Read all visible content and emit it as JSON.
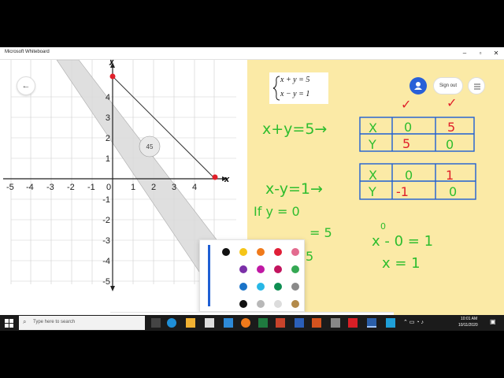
{
  "window": {
    "title": "Microsoft Whiteboard",
    "minimize": "–",
    "maximize": "▫",
    "close": "✕"
  },
  "header": {
    "back_icon": "←",
    "signout_label": "Sign out"
  },
  "equation_card": {
    "line1": "x + y = 5",
    "line2": "x − y = 1"
  },
  "graph": {
    "x_ticks": [
      "-5",
      "-4",
      "-3",
      "-2",
      "-1",
      "0",
      "1",
      "2",
      "3",
      "4"
    ],
    "y_ticks": [
      "4",
      "3",
      "2",
      "1",
      "-1",
      "-2",
      "-3",
      "-4",
      "-5"
    ],
    "x_label": "x",
    "y_label": "y",
    "ruler_angle": "45"
  },
  "notes": {
    "eq1": "x+y=5→",
    "eq2": "x-y=1→",
    "checks": [
      "✓",
      "✓"
    ],
    "table1": {
      "row1": [
        "X",
        "0",
        "5"
      ],
      "row2": [
        "Y",
        "5",
        "0"
      ]
    },
    "table2": {
      "row1": [
        "X",
        "0",
        "1"
      ],
      "row2": [
        "Y",
        "-1",
        "0"
      ]
    },
    "if_line": "If y = 0",
    "partial1": "= 5",
    "partial2": "5",
    "step1": "x - 0 = 1",
    "step_small": "0",
    "step2": "x = 1"
  },
  "palette_colors": [
    "#111111",
    "#f5c518",
    "#f07a1b",
    "#e01e37",
    "#e36b8f",
    "#7b2fa8",
    "#c018a4",
    "#c2145e",
    "#34a853",
    "#1a73c8",
    "#27b7e6",
    "#0e8e52",
    "#8a8a8a",
    "#111111",
    "#b8b8b8",
    "#dcdcdc",
    "#b38a4a"
  ],
  "taskbar": {
    "search_placeholder": "Type here to search",
    "time": "10:01 AM",
    "date": "10/11/2020"
  },
  "colors": {
    "accent": "#2860d8",
    "sticky": "#fbeaa6",
    "ink_green": "#2ebd2e",
    "ink_red": "#e0202a",
    "ink_blue": "#1f5fd4"
  }
}
